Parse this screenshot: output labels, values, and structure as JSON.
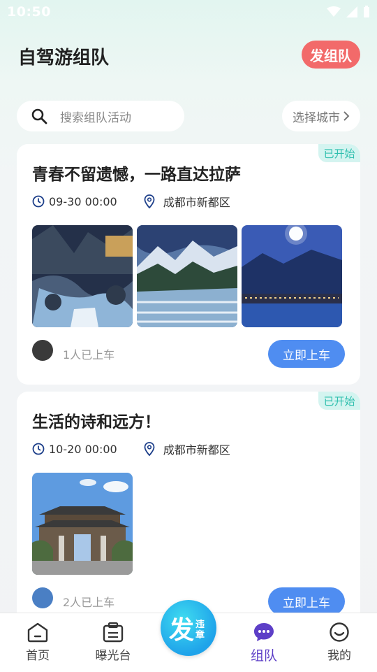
{
  "status_bar": {
    "time": "10:50"
  },
  "header": {
    "title": "自驾游组队",
    "new_team_label": "发组队"
  },
  "search": {
    "placeholder": "搜索组队活动",
    "city_label": "选择城市"
  },
  "cards": [
    {
      "badge": "已开始",
      "title": "青春不留遗憾，一路直达拉萨",
      "time": "09-30 00:00",
      "location": "成都市新都区",
      "riders": "1人已上车",
      "button": "立即上车"
    },
    {
      "badge": "已开始",
      "title": "生活的诗和远方！",
      "time": "10-20 00:00",
      "location": "成都市新都区",
      "riders": "2人已上车",
      "button": "立即上车"
    }
  ],
  "tabbar": {
    "items": [
      {
        "label": "首页",
        "icon": "home-icon"
      },
      {
        "label": "曝光台",
        "icon": "clipboard-icon"
      },
      {
        "label": "组队",
        "icon": "chat-icon",
        "active": true
      },
      {
        "label": "我的",
        "icon": "smile-icon"
      }
    ],
    "fab": {
      "big": "发",
      "small": "违章"
    }
  },
  "colors": {
    "accent_red": "#f26a6a",
    "button_blue": "#4f8df1",
    "active_tab": "#5d3fc7",
    "badge_teal": "#2fbfae"
  }
}
